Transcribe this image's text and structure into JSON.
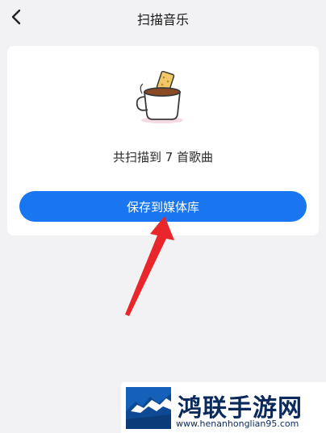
{
  "header": {
    "title": "扫描音乐",
    "back_icon": "chevron-left-icon"
  },
  "result": {
    "illustration_icon": "coffee-cup-icon",
    "summary": "共扫描到 7 首歌曲",
    "save_button_label": "保存到媒体库"
  },
  "annotation": {
    "arrow_color": "#e8262b"
  },
  "watermark": {
    "title": "鸿联手游网",
    "url": "www.henanhonglian95.com"
  },
  "colors": {
    "background": "#f2f2f4",
    "card": "#ffffff",
    "primary": "#1976f0"
  }
}
